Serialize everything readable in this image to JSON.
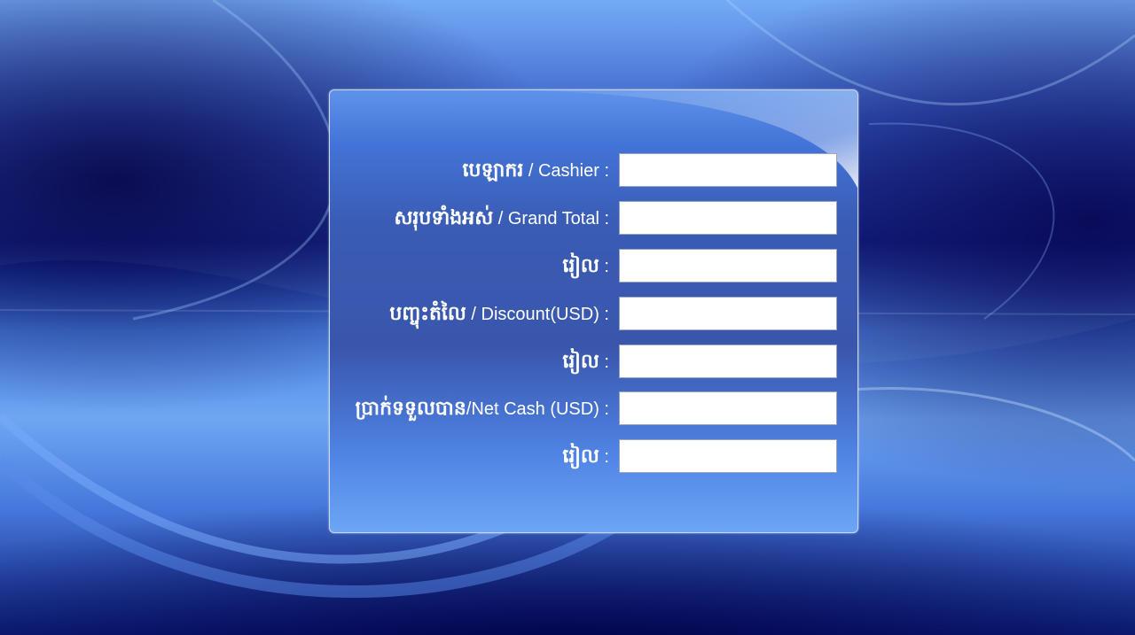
{
  "form": {
    "rows": [
      {
        "km": "បេឡាករ",
        "en": " / Cashier :",
        "value": "",
        "placeholder": ""
      },
      {
        "km": "សរុបទាំងអស់",
        "en": " / Grand Total :",
        "value": "",
        "placeholder": ""
      },
      {
        "km": "រៀល",
        "en": " :",
        "value": "",
        "placeholder": ""
      },
      {
        "km": "បញ្ចុះតំលៃ",
        "en": " / Discount(USD) :",
        "value": "",
        "placeholder": ""
      },
      {
        "km": "រៀល",
        "en": " :",
        "value": "",
        "placeholder": ""
      },
      {
        "km": "ប្រាក់ទទួលបាន",
        "en": "/Net Cash (USD) :",
        "value": "",
        "placeholder": ""
      },
      {
        "km": "រៀល",
        "en": " :",
        "value": "",
        "placeholder": ""
      }
    ]
  },
  "colors": {
    "panel": "#3956ac",
    "label_text": "#ffffff",
    "field_bg": "#ffffff"
  }
}
